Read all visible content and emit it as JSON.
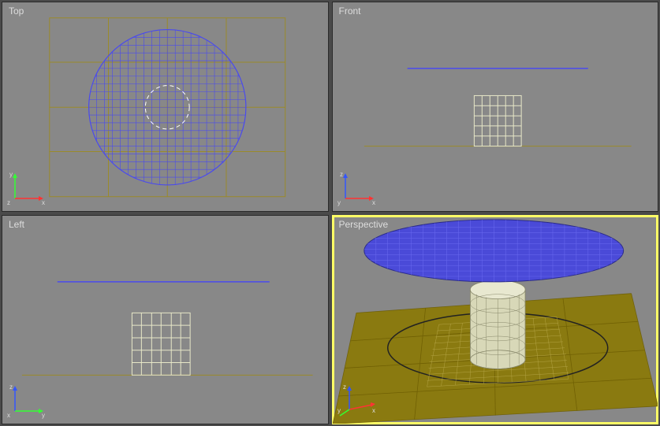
{
  "viewports": {
    "top": {
      "label": "Top",
      "active": false,
      "axes": {
        "up_label": "y",
        "up_color": "#33ff33",
        "right_label": "x",
        "right_color": "#ff3333",
        "origin_label": "z"
      }
    },
    "front": {
      "label": "Front",
      "active": false,
      "axes": {
        "up_label": "z",
        "up_color": "#3355ff",
        "right_label": "x",
        "right_color": "#ff3333",
        "origin_label": "y"
      }
    },
    "left": {
      "label": "Left",
      "active": false,
      "axes": {
        "up_label": "z",
        "up_color": "#3355ff",
        "right_label": "y",
        "right_color": "#33ff33",
        "origin_label": "x"
      }
    },
    "perspective": {
      "label": "Perspective",
      "active": true,
      "axes": {
        "up_label": "z",
        "up_color": "#3355ff",
        "right_label": "x",
        "right_color": "#ff3333",
        "origin_label": "y"
      }
    }
  },
  "colors": {
    "ground_grid": "#9a8a2a",
    "circle_wire": "#4a4aee",
    "cylinder_wire": "#e8e8c8",
    "bg": "#888888",
    "safe_frame_dash": "#ffffff",
    "perspective_floor": "#8a7a10",
    "perspective_disc": "#4a4ad8",
    "perspective_cyl": "#d8d8b8",
    "shadow_ellipse": "#222222"
  }
}
